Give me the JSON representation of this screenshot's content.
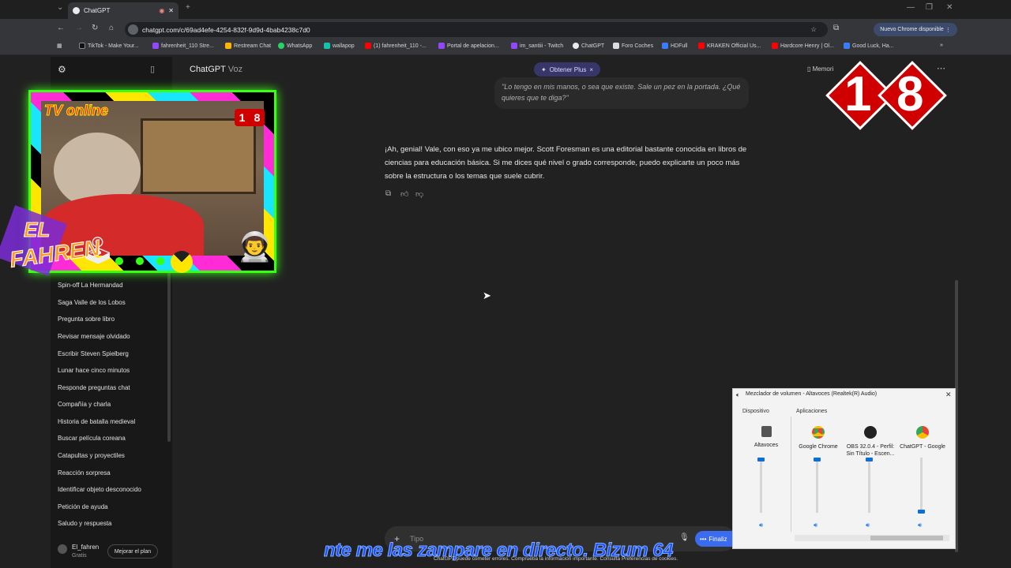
{
  "browser": {
    "tab_title": "ChatGPT",
    "url": "chatgpt.com/c/69ad4efe-4254-832f-9d9d-4bab4238c7d0",
    "update_label": "Nuevo Chrome disponible",
    "bookmarks": [
      "TikTok - Make Your...",
      "fahrenheit_110 Stre...",
      "Restream Chat",
      "WhatsApp",
      "wallapop",
      "(1) fahrenheit_110 -...",
      "Portal de apelacion...",
      "im_santiii - Twitch",
      "ChatGPT",
      "Foro Coches",
      "HDFull",
      "KRAKEN Official Us...",
      "Hardcore Henry | Ol...",
      "Good Luck, Ha..."
    ]
  },
  "header": {
    "title": "ChatGPT",
    "title_suffix": "Voz",
    "plus_label": "Obtener Plus",
    "memory_label": "Memori"
  },
  "conversation": {
    "user_message": "\"Lo tengo en mis manos, o sea que existe. Sale un pez en la portada. ¿Qué quieres que te diga?\"",
    "assistant_message": "¡Ah, genial! Vale, con eso ya me ubico mejor. Scott Foresman es una editorial bastante conocida en libros de ciencias para educación básica. Si me dices qué nivel o grado corresponde, puedo explicarte un poco más sobre la estructura o los temas que suele cubrir."
  },
  "sidebar": {
    "items": [
      "Spin-off La Hermandad",
      "Saga Valle de los Lobos",
      "Pregunta sobre libro",
      "Revisar mensaje olvidado",
      "Escribir Steven Spielberg",
      "Lunar hace cinco minutos",
      "Responde preguntas chat",
      "Compañía y charla",
      "Historia de batalla medieval",
      "Buscar película coreana",
      "Catapultas y proyectiles",
      "Reacción sorpresa",
      "Identificar objeto desconocido",
      "Petición de ayuda",
      "Saludo y respuesta"
    ],
    "user_name": "El_fahren",
    "user_plan": "Gratis",
    "upgrade_label": "Mejorar el plan"
  },
  "composer": {
    "placeholder": "Tipo",
    "finish_label": "Finaliz",
    "disclaimer": "ChatGPT puede cometer errores. Comprueba la información importante. Consulta Preferencias de cookies."
  },
  "overlay": {
    "cam_logo": "TV online",
    "fahren_logo_1": "EL",
    "fahren_logo_2": "FAHREN",
    "age_1": "1",
    "age_2": "8",
    "ticker": "nte me las zampare en directo. Bizum 64"
  },
  "mixer": {
    "title": "Mezclador de volumen - Altavoces (Realtek(R) Audio)",
    "device_header": "Dispositivo",
    "apps_header": "Aplicaciones",
    "columns": [
      {
        "name": "Altavoces",
        "level": 1.0
      },
      {
        "name": "Google Chrome",
        "level": 1.0
      },
      {
        "name": "OBS 32.0.4 - Perfil: Sin Título - Escen...",
        "level": 1.0
      },
      {
        "name": "ChatGPT - Google",
        "level": 0.0
      }
    ]
  },
  "colors": {
    "background": "#212121",
    "sidebar": "#181818",
    "accent_plus": "#373669",
    "neon_green": "#39ff14",
    "age_red": "#d10000"
  }
}
